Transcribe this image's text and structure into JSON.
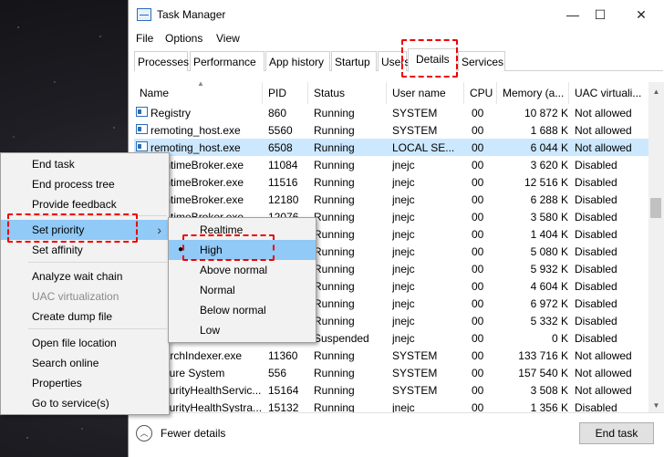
{
  "window": {
    "title": "Task Manager",
    "controls": {
      "minimize": "—",
      "maximize": "☐",
      "close": "✕"
    }
  },
  "menubar": [
    "File",
    "Options",
    "View"
  ],
  "tabs": [
    "Processes",
    "Performance",
    "App history",
    "Startup",
    "Users",
    "Details",
    "Services"
  ],
  "active_tab": "Details",
  "columns": [
    "Name",
    "PID",
    "Status",
    "User name",
    "CPU",
    "Memory (a...",
    "UAC virtuali..."
  ],
  "rows": [
    {
      "name": "Registry",
      "pid": "860",
      "status": "Running",
      "user": "SYSTEM",
      "cpu": "00",
      "memory": "10 872 K",
      "uac": "Not allowed"
    },
    {
      "name": "remoting_host.exe",
      "pid": "5560",
      "status": "Running",
      "user": "SYSTEM",
      "cpu": "00",
      "memory": "1 688 K",
      "uac": "Not allowed"
    },
    {
      "name": "remoting_host.exe",
      "pid": "6508",
      "status": "Running",
      "user": "LOCAL SE...",
      "cpu": "00",
      "memory": "6 044 K",
      "uac": "Not allowed",
      "selected": true
    },
    {
      "name": "RuntimeBroker.exe",
      "pid": "11084",
      "status": "Running",
      "user": "jnejc",
      "cpu": "00",
      "memory": "3 620 K",
      "uac": "Disabled"
    },
    {
      "name": "RuntimeBroker.exe",
      "pid": "11516",
      "status": "Running",
      "user": "jnejc",
      "cpu": "00",
      "memory": "12 516 K",
      "uac": "Disabled"
    },
    {
      "name": "RuntimeBroker.exe",
      "pid": "12180",
      "status": "Running",
      "user": "jnejc",
      "cpu": "00",
      "memory": "6 288 K",
      "uac": "Disabled"
    },
    {
      "name": "RuntimeBroker.exe",
      "pid": "12076",
      "status": "Running",
      "user": "jnejc",
      "cpu": "00",
      "memory": "3 580 K",
      "uac": "Disabled"
    },
    {
      "name": "",
      "pid": "",
      "status": "Running",
      "user": "jnejc",
      "cpu": "00",
      "memory": "1 404 K",
      "uac": "Disabled"
    },
    {
      "name": "",
      "pid": "",
      "status": "Running",
      "user": "jnejc",
      "cpu": "00",
      "memory": "5 080 K",
      "uac": "Disabled"
    },
    {
      "name": "",
      "pid": "",
      "status": "Running",
      "user": "jnejc",
      "cpu": "00",
      "memory": "5 932 K",
      "uac": "Disabled"
    },
    {
      "name": "",
      "pid": "",
      "status": "Running",
      "user": "jnejc",
      "cpu": "00",
      "memory": "4 604 K",
      "uac": "Disabled"
    },
    {
      "name": "",
      "pid": "",
      "status": "Running",
      "user": "jnejc",
      "cpu": "00",
      "memory": "6 972 K",
      "uac": "Disabled"
    },
    {
      "name": "",
      "pid": "",
      "status": "Running",
      "user": "jnejc",
      "cpu": "00",
      "memory": "5 332 K",
      "uac": "Disabled"
    },
    {
      "name": "",
      "pid": "",
      "status": "Suspended",
      "user": "jnejc",
      "cpu": "00",
      "memory": "0 K",
      "uac": "Disabled"
    },
    {
      "name": "SearchIndexer.exe",
      "pid": "11360",
      "status": "Running",
      "user": "SYSTEM",
      "cpu": "00",
      "memory": "133 716 K",
      "uac": "Not allowed"
    },
    {
      "name": "Secure System",
      "pid": "556",
      "status": "Running",
      "user": "SYSTEM",
      "cpu": "00",
      "memory": "157 540 K",
      "uac": "Not allowed"
    },
    {
      "name": "SecurityHealthServic...",
      "pid": "15164",
      "status": "Running",
      "user": "SYSTEM",
      "cpu": "00",
      "memory": "3 508 K",
      "uac": "Not allowed"
    },
    {
      "name": "SecurityHealthSystra...",
      "pid": "15132",
      "status": "Running",
      "user": "jnejc",
      "cpu": "00",
      "memory": "1 356 K",
      "uac": "Disabled"
    }
  ],
  "footer": {
    "fewer_details": "Fewer details",
    "end_task": "End task"
  },
  "context_menu": {
    "items": [
      {
        "label": "End task"
      },
      {
        "label": "End process tree"
      },
      {
        "label": "Provide feedback"
      },
      {
        "label": "Set priority",
        "submenu": true,
        "hover": true
      },
      {
        "label": "Set affinity"
      },
      {
        "label": "Analyze wait chain"
      },
      {
        "label": "UAC virtualization",
        "disabled": true
      },
      {
        "label": "Create dump file"
      },
      {
        "label": "Open file location"
      },
      {
        "label": "Search online"
      },
      {
        "label": "Properties"
      },
      {
        "label": "Go to service(s)"
      }
    ]
  },
  "priority_menu": {
    "items": [
      "Realtime",
      "High",
      "Above normal",
      "Normal",
      "Below normal",
      "Low"
    ],
    "current": "High",
    "bullet": "●"
  },
  "colors": {
    "selection": "#cce8ff",
    "menu_hover": "#91c9f7",
    "annotation": "#e00000"
  }
}
